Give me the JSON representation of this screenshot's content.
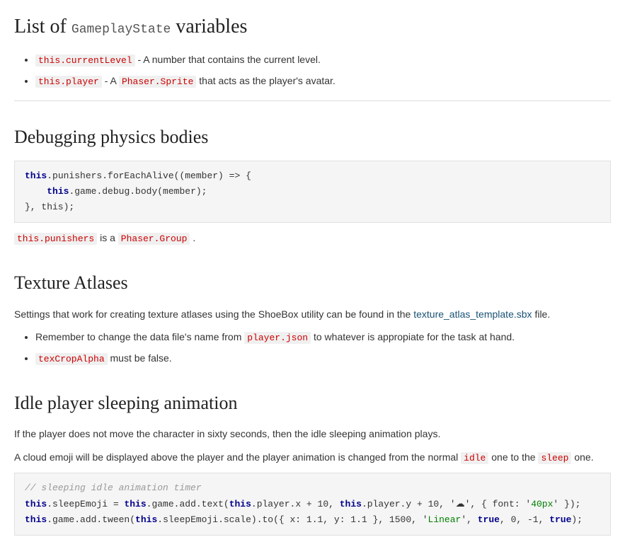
{
  "sections": [
    {
      "id": "variables",
      "heading_prefix": "List of",
      "heading_inline_code": "GameplayState",
      "heading_suffix": "variables",
      "bullets": [
        {
          "code": "this.currentLevel",
          "text": " - A number that contains the current level."
        },
        {
          "code": "this.player",
          "text": " - A ",
          "link_code": "Phaser.Sprite",
          "link_href": "#",
          "text2": " that acts as the player's avatar."
        }
      ]
    },
    {
      "id": "debugging",
      "heading": "Debugging physics bodies",
      "code_block_lines": [
        {
          "type": "kw_text",
          "kw": "this",
          "rest": ".punishers.forEachAlive((member) => {"
        },
        {
          "type": "indent_kw_text",
          "indent": "    ",
          "kw": "this",
          "rest": ".game.debug.body(member);"
        },
        {
          "type": "text",
          "text": "}, this);"
        }
      ],
      "inline_text_before": "",
      "inline_parts": [
        {
          "code": "this.punishers"
        },
        {
          "text": " is a "
        },
        {
          "code": "Phaser.Group"
        },
        {
          "text": "."
        }
      ]
    },
    {
      "id": "texture",
      "heading": "Texture Atlases",
      "description": "Settings that work for creating texture atlases using the ShoeBox utility can be found in the ",
      "link_text": "texture_atlas_template.sbx",
      "link_href": "#",
      "description_end": " file.",
      "bullets": [
        {
          "text_before": "Remember to change the data file's name from ",
          "code": "player.json",
          "text_after": " to whatever is appropiate for the task at hand."
        },
        {
          "code": "texCropAlpha",
          "text_after": " must be false."
        }
      ]
    },
    {
      "id": "idle-animation",
      "heading": "Idle player sleeping animation",
      "para1": "If the player does not move the character in sixty seconds, then the idle sleeping animation plays.",
      "para2_before": "A cloud emoji will be displayed above the player and the player animation is changed from the normal ",
      "para2_code1": "idle",
      "para2_mid": " one to the ",
      "para2_code2": "sleep",
      "para2_end": " one.",
      "code_lines": [
        {
          "type": "comment",
          "text": "// sleeping idle animation timer"
        },
        {
          "type": "code",
          "parts": [
            {
              "kw": "this"
            },
            {
              "t": ".sleepEmoji = "
            },
            {
              "kw": "this"
            },
            {
              "t": ".game.add.text("
            },
            {
              "kw": "this"
            },
            {
              "t": ".player.x + 10, "
            },
            {
              "kw": "this"
            },
            {
              "t": ".player.y + 10, '☁', { font: '"
            },
            {
              "str": "40px"
            },
            {
              "t": "' });"
            }
          ]
        },
        {
          "type": "code",
          "parts": [
            {
              "kw": "this"
            },
            {
              "t": ".game.add.tween("
            },
            {
              "kw": "this"
            },
            {
              "t": ".sleepEmoji.scale).to({ x: 1.1, y: 1.1 }, 1500, '"
            },
            {
              "str": "Linear"
            },
            {
              "t": "', "
            },
            {
              "kw": "true"
            },
            {
              "t": ", 0, -1, "
            },
            {
              "kw": "true"
            },
            {
              "t": ");"
            }
          ]
        }
      ]
    }
  ],
  "colors": {
    "heading": "#222222",
    "link": "#1a5276",
    "code_bg": "#f0f0f0",
    "code_block_bg": "#f5f5f5",
    "keyword": "#00008b",
    "string": "#008000",
    "number": "#0000ff",
    "comment": "#999999",
    "inline_code_color": "#c00000"
  }
}
